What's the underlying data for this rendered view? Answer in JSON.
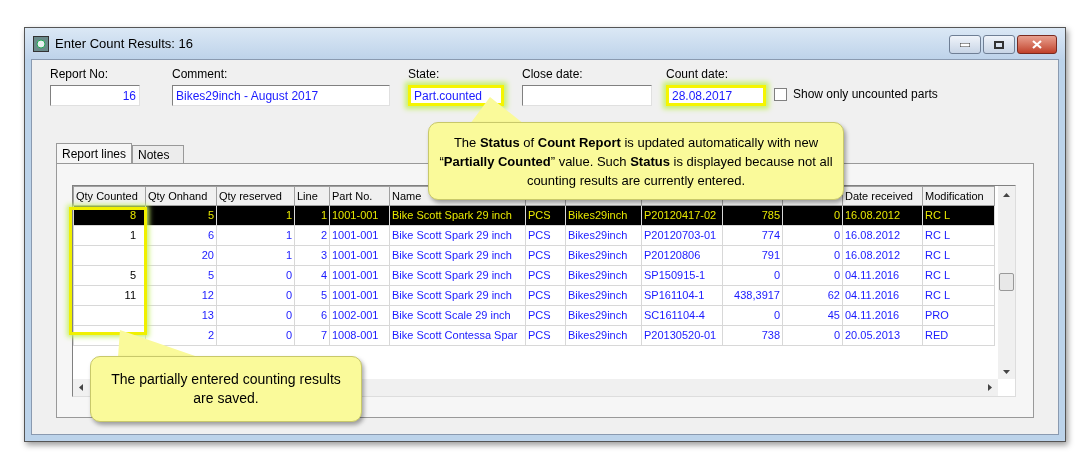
{
  "window": {
    "title": "Enter Count Results: 16"
  },
  "fields": [
    {
      "label": "Report No:",
      "value": "16",
      "kind": "number",
      "highlighted": false
    },
    {
      "label": "Comment:",
      "value": "Bikes29inch - August 2017",
      "kind": "text",
      "highlighted": false
    },
    {
      "label": "State:",
      "value": "Part.counted",
      "kind": "text",
      "highlighted": true
    },
    {
      "label": "Close date:",
      "kind": "text",
      "highlighted": false
    },
    {
      "label": "Count date:",
      "value": "28.08.2017",
      "kind": "text",
      "highlighted": true
    }
  ],
  "show_only_uncounted": {
    "label": "Show only uncounted parts",
    "checked": false
  },
  "tabs": [
    {
      "label": "Report lines",
      "selected": true
    },
    {
      "label": "Notes",
      "selected": false
    }
  ],
  "table": {
    "columns": [
      {
        "label": "Qty Counted",
        "kind": "number"
      },
      {
        "label": "Qty Onhand",
        "kind": "number"
      },
      {
        "label": "Qty reserved",
        "kind": "number"
      },
      {
        "label": "Line",
        "kind": "number"
      },
      {
        "label": "Part No.",
        "kind": "text"
      },
      {
        "label": "Name",
        "kind": "text"
      },
      {
        "kind": "text"
      },
      {
        "kind": "text"
      },
      {
        "kind": "text"
      },
      {
        "kind": "number"
      },
      {
        "kind": "number"
      },
      {
        "label": "Date received",
        "kind": "text"
      },
      {
        "label": "Modification",
        "kind": "text"
      }
    ],
    "rows": [
      {
        "selected": true,
        "cells": [
          "8",
          "5",
          "1",
          "1",
          "1001-001",
          "Bike Scott Spark 29 inch",
          "PCS",
          "Bikes29inch",
          "P20120417-02",
          "785",
          "0",
          "16.08.2012",
          "RC L"
        ]
      },
      {
        "selected": false,
        "cells": [
          "1",
          "6",
          "1",
          "2",
          "1001-001",
          "Bike Scott Spark 29 inch",
          "PCS",
          "Bikes29inch",
          "P20120703-01",
          "774",
          "0",
          "16.08.2012",
          "RC L"
        ]
      },
      {
        "selected": false,
        "cells": [
          "",
          "20",
          "1",
          "3",
          "1001-001",
          "Bike Scott Spark 29 inch",
          "PCS",
          "Bikes29inch",
          "P20120806",
          "791",
          "0",
          "16.08.2012",
          "RC L"
        ]
      },
      {
        "selected": false,
        "cells": [
          "5",
          "5",
          "0",
          "4",
          "1001-001",
          "Bike Scott Spark 29 inch",
          "PCS",
          "Bikes29inch",
          "SP150915-1",
          "0",
          "0",
          "04.11.2016",
          "RC L"
        ]
      },
      {
        "selected": false,
        "cells": [
          "11",
          "12",
          "0",
          "5",
          "1001-001",
          "Bike Scott Spark 29 inch",
          "PCS",
          "Bikes29inch",
          "SP161104-1",
          "438,3917",
          "62",
          "04.11.2016",
          "RC L"
        ]
      },
      {
        "selected": false,
        "cells": [
          "",
          "13",
          "0",
          "6",
          "1002-001",
          "Bike Scott Scale 29 inch",
          "PCS",
          "Bikes29inch",
          "SC161104-4",
          "0",
          "45",
          "04.11.2016",
          "PRO"
        ]
      },
      {
        "selected": false,
        "cells": [
          "",
          "2",
          "0",
          "7",
          "1008-001",
          "Bike Scott Contessa Spar",
          "PCS",
          "Bikes29inch",
          "P20130520-01",
          "738",
          "0",
          "20.05.2013",
          "RED"
        ]
      }
    ]
  },
  "callouts": [
    {
      "text": "The **Status** of **Count Report** is updated automatically with new “**Partially Counted**” value.  Such **Status** is displayed because not all counting results are currently entered."
    },
    {
      "text": "The partially entered counting results are saved."
    }
  ]
}
